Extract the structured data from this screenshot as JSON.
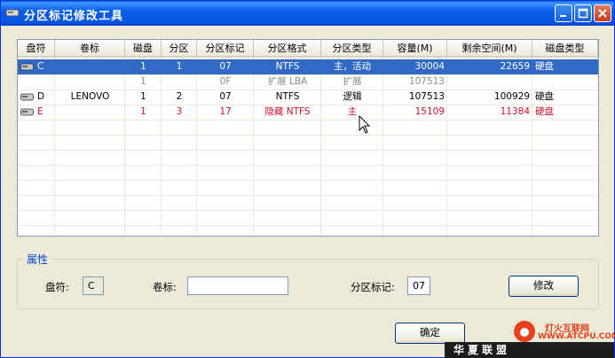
{
  "window": {
    "title": "分区标记修改工具"
  },
  "columns": [
    "盘符",
    "卷标",
    "磁盘",
    "分区",
    "分区标记",
    "分区格式",
    "分区类型",
    "容量(M)",
    "剩余空间(M)",
    "磁盘类型"
  ],
  "rows": [
    {
      "drive": "C",
      "label": "",
      "disk": "1",
      "part": "1",
      "mark": "07",
      "format": "NTFS",
      "type": "主，活动",
      "size": "30004",
      "free": "22659",
      "dtype": "硬盘"
    },
    {
      "drive": "",
      "label": "",
      "disk": "1",
      "part": "",
      "mark": "0F",
      "format": "扩展 LBA",
      "type": "扩展",
      "size": "107513",
      "free": "",
      "dtype": ""
    },
    {
      "drive": "D",
      "label": "LENOVO",
      "disk": "1",
      "part": "2",
      "mark": "07",
      "format": "NTFS",
      "type": "逻辑",
      "size": "107513",
      "free": "100929",
      "dtype": "硬盘"
    },
    {
      "drive": "E",
      "label": "",
      "disk": "1",
      "part": "3",
      "mark": "17",
      "format": "隐藏 NTFS",
      "type": "主",
      "size": "15109",
      "free": "11384",
      "dtype": "硬盘"
    }
  ],
  "properties": {
    "group_title": "属性",
    "drive_label": "盘符:",
    "drive_value": "C",
    "volume_label": "卷标:",
    "volume_value": "",
    "mark_label": "分区标记:",
    "mark_value": "07",
    "modify_button": "修改"
  },
  "ok_button": "确定",
  "watermark": {
    "brand": "灯火互联网",
    "url": "WWW.ATCPU.COM",
    "site": "华夏联盟"
  },
  "colors": {
    "selected": "#316ac5",
    "red_row": "#c8102e",
    "title_blue": "#0a5fe8"
  }
}
